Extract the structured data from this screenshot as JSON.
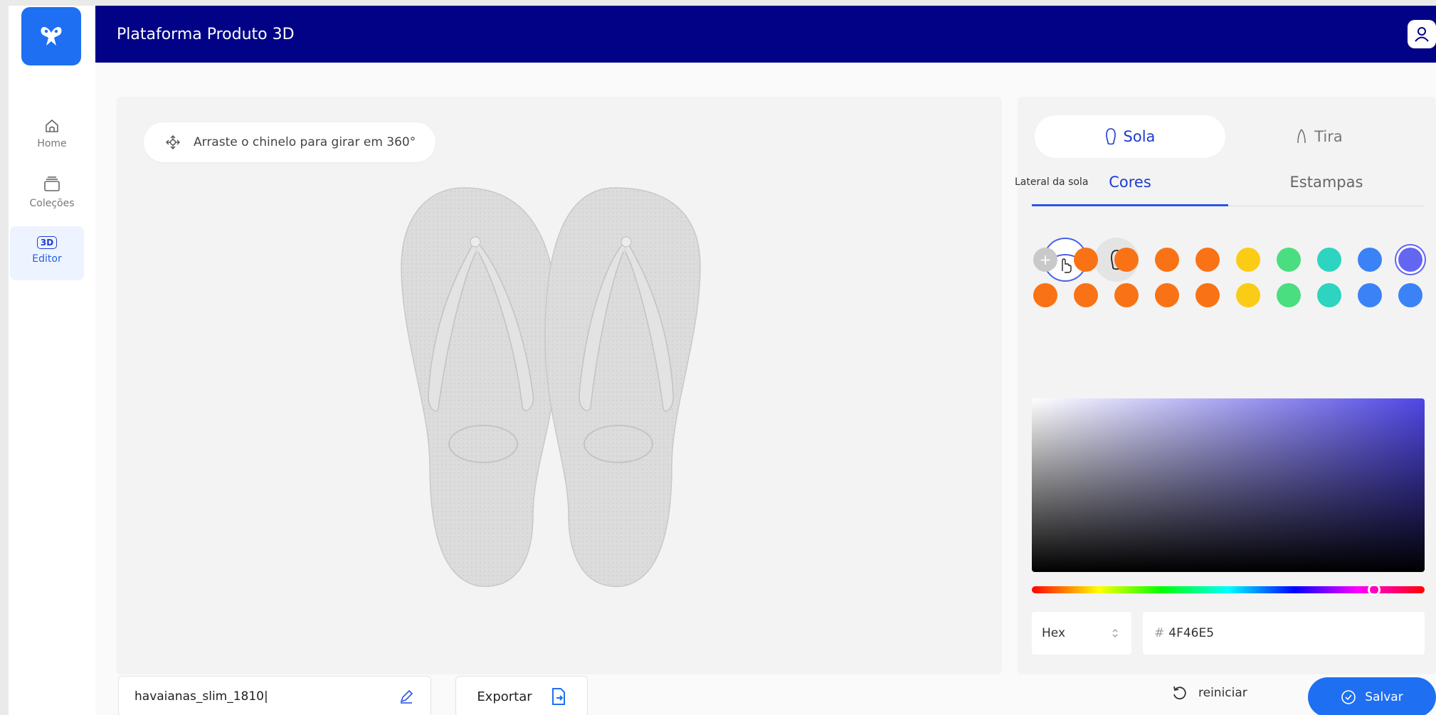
{
  "app": {
    "title": "Plataforma Produto 3D"
  },
  "sidebar": {
    "items": [
      {
        "label": "Home",
        "icon": "home-icon"
      },
      {
        "label": "Coleções",
        "icon": "collections-icon"
      },
      {
        "label": "Editor",
        "icon": "3d-icon",
        "badge": "3D",
        "active": true
      }
    ]
  },
  "viewer": {
    "hint": "Arraste o chinelo para girar em 360°"
  },
  "panel": {
    "part_tabs": [
      {
        "label": "Sola",
        "icon": "sole-icon",
        "active": true
      },
      {
        "label": "Tira",
        "icon": "strap-icon",
        "active": false
      }
    ],
    "sub_tabs": [
      {
        "label": "Cores",
        "active": true
      },
      {
        "label": "Estampas",
        "active": false
      }
    ],
    "tooltip": "Lateral da sola",
    "swatches_row1": [
      "#c9c9c9",
      "#f97316",
      "#f97316",
      "#f97316",
      "#f97316",
      "#facc15",
      "#4ade80",
      "#2dd4bf",
      "#3b82f6",
      "#6366f1"
    ],
    "swatches_row2": [
      "#f97316",
      "#f97316",
      "#f97316",
      "#f97316",
      "#f97316",
      "#facc15",
      "#4ade80",
      "#2dd4bf",
      "#3b82f6",
      "#3b82f6"
    ],
    "picker": {
      "format": "Hex",
      "hex_value": "4F46E5",
      "selected_color": "#4F46E5"
    }
  },
  "bottom": {
    "file_name": "havaianas_slim_1810|",
    "export_label": "Exportar",
    "reset_label": "reiniciar",
    "save_label": "Salvar"
  },
  "colors": {
    "header": "#020286",
    "accent": "#1f6ff2",
    "active_tab_text": "#1f3ad0"
  }
}
